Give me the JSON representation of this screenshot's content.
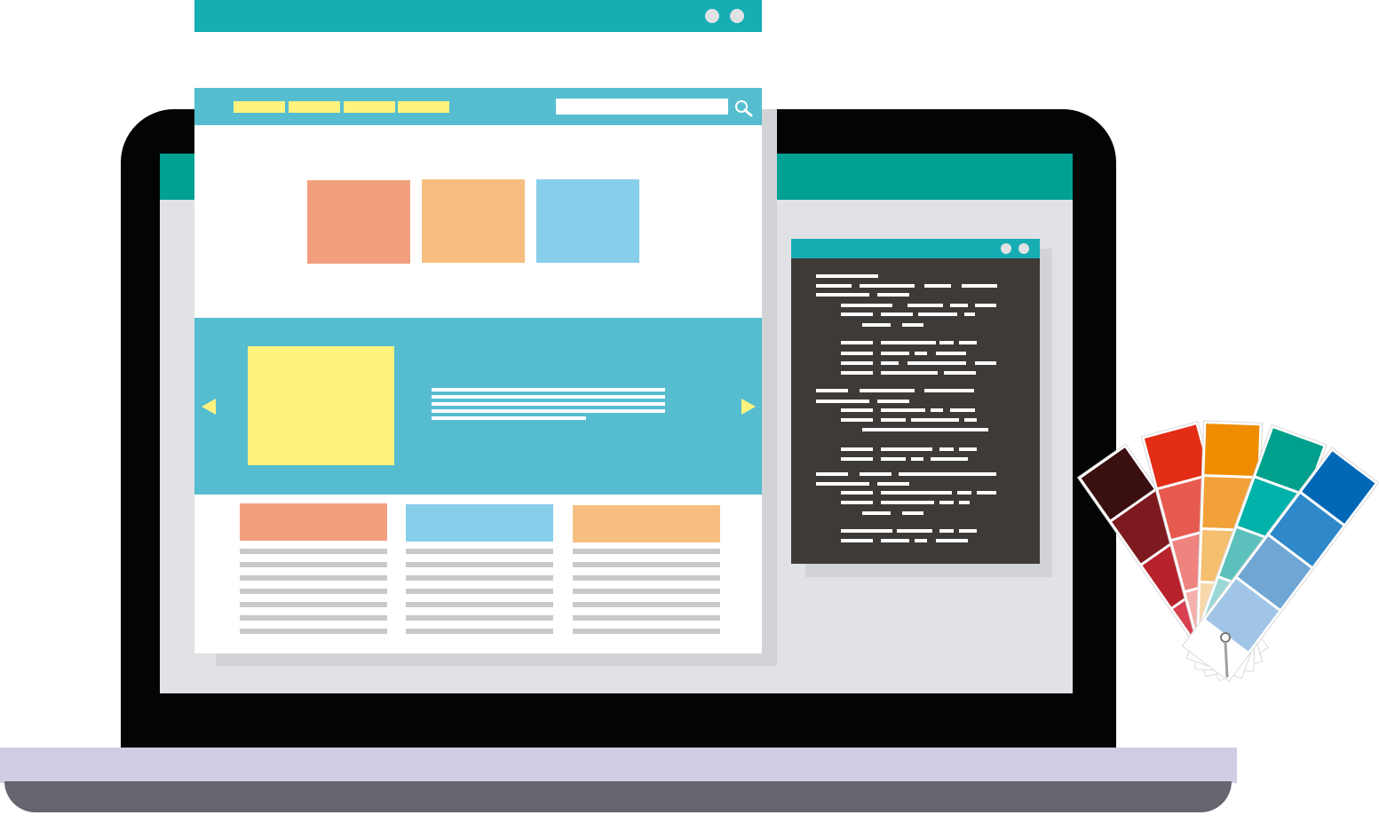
{
  "colors": {
    "teal_dark": "#00a094",
    "teal_bar": "#16adb3",
    "nav_blue": "#55bdcf",
    "yellow": "#fff37e",
    "salmon": "#f29f7e",
    "orange_light": "#f6bf80",
    "sky_blue": "#87ceeb",
    "code_bg": "#3d3a38",
    "laptop_black": "#030505",
    "base_lavender": "#cfcce3",
    "base_gray": "#67646e"
  },
  "icons": {
    "search": "search-icon",
    "prev": "arrow-left-icon",
    "next": "arrow-right-icon",
    "window_control": "window-dot-icon",
    "swatches": "color-swatch-fan-icon"
  },
  "swatch_strips": [
    {
      "name": "dark-red-strip",
      "colors": [
        "#3a0f10",
        "#7d1a1f",
        "#b8222c",
        "#d84050"
      ]
    },
    {
      "name": "red-strip",
      "colors": [
        "#e32d14",
        "#e75a4f",
        "#ee8380",
        "#f3b0ad"
      ]
    },
    {
      "name": "orange-strip",
      "colors": [
        "#f08c00",
        "#f2a138",
        "#f5bf70",
        "#f8d8a8"
      ]
    },
    {
      "name": "teal-strip",
      "colors": [
        "#00a08c",
        "#00b2a9",
        "#5cc1bc",
        "#9bd7d6"
      ]
    },
    {
      "name": "blue-strip",
      "colors": [
        "#0068b7",
        "#2e88c9",
        "#70a6d4",
        "#a1c5e6"
      ]
    }
  ]
}
